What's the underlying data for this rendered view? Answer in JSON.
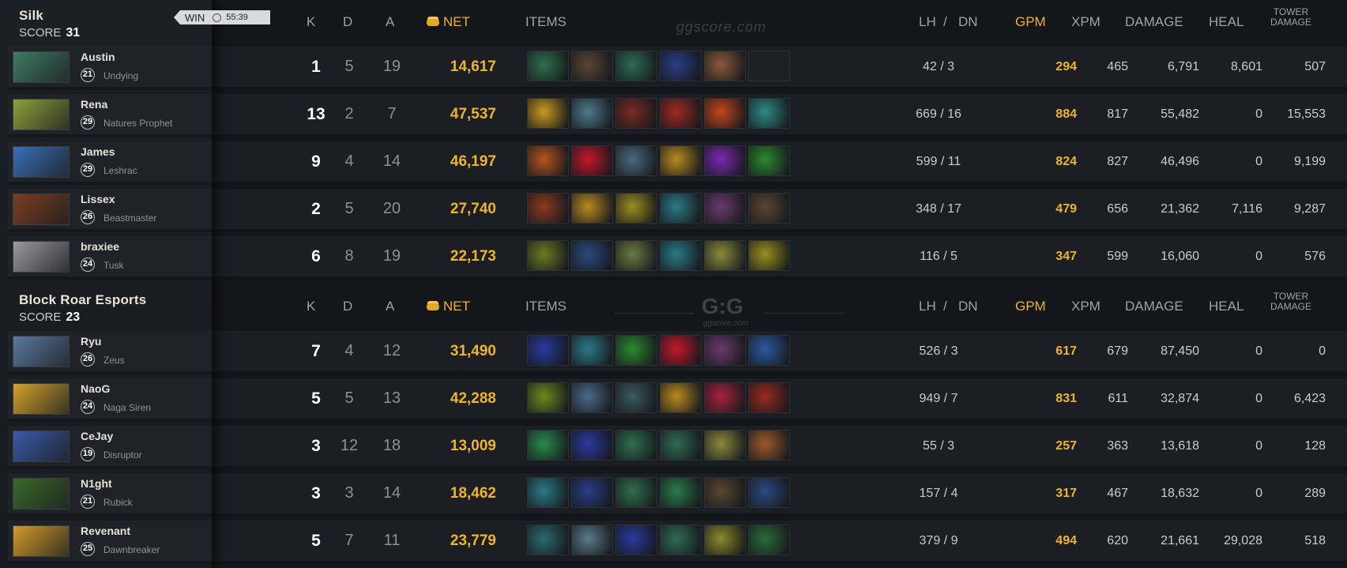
{
  "match": {
    "result": "WIN",
    "duration": "55:39"
  },
  "headers": {
    "k": "K",
    "d": "D",
    "a": "A",
    "net": "NET",
    "items": "ITEMS",
    "lh": "LH",
    "slash": "/",
    "dn": "DN",
    "gpm": "GPM",
    "xpm": "XPM",
    "damage": "DAMAGE",
    "heal": "HEAL",
    "tower_1": "TOWER",
    "tower_2": "DAMAGE",
    "watermark": "ggscore.com",
    "logo": "G:G",
    "logo_sub": "ggscore.com"
  },
  "teams": [
    {
      "name": "Silk",
      "score_label": "SCORE",
      "score": "31",
      "players": [
        {
          "name": "Austin",
          "level": "21",
          "hero": "Undying",
          "k": "1",
          "d": "5",
          "a": "19",
          "net": "14,617",
          "lh_dn": "42  /  3",
          "gpm": "294",
          "xpm": "465",
          "damage": "6,791",
          "heal": "8,601",
          "tower": "507",
          "portrait": "#3f7b66",
          "items": [
            "#2f6f4e",
            "#5a4632",
            "#2e6b54",
            "#2a3d86",
            "#8a5a3a",
            "#1e2124"
          ]
        },
        {
          "name": "Rena",
          "level": "29",
          "hero": "Natures Prophet",
          "k": "13",
          "d": "2",
          "a": "7",
          "net": "47,537",
          "lh_dn": "669  /  16",
          "gpm": "884",
          "xpm": "817",
          "damage": "55,482",
          "heal": "0",
          "tower": "15,553",
          "portrait": "#8fa03a",
          "items": [
            "#c99a1e",
            "#4d7a8a",
            "#7a2a24",
            "#9e2a22",
            "#c4461c",
            "#2e8a86"
          ]
        },
        {
          "name": "James",
          "level": "29",
          "hero": "Leshrac",
          "k": "9",
          "d": "4",
          "a": "14",
          "net": "46,197",
          "lh_dn": "599  /  11",
          "gpm": "824",
          "xpm": "827",
          "damage": "46,496",
          "heal": "0",
          "tower": "9,199",
          "portrait": "#3a6fb5",
          "items": [
            "#b4541e",
            "#c4182a",
            "#4a6a7e",
            "#b88a1e",
            "#7a28b0",
            "#2a8a2e"
          ]
        },
        {
          "name": "Lissex",
          "level": "26",
          "hero": "Beastmaster",
          "k": "2",
          "d": "5",
          "a": "20",
          "net": "27,740",
          "lh_dn": "348  /  17",
          "gpm": "479",
          "xpm": "656",
          "damage": "21,362",
          "heal": "7,116",
          "tower": "9,287",
          "portrait": "#7a3e22",
          "items": [
            "#8a3a1e",
            "#b88a1e",
            "#9a8e1e",
            "#2a7a86",
            "#6a3a6e",
            "#5a4632"
          ]
        },
        {
          "name": "braxiee",
          "level": "24",
          "hero": "Tusk",
          "k": "6",
          "d": "8",
          "a": "19",
          "net": "22,173",
          "lh_dn": "116  /  5",
          "gpm": "347",
          "xpm": "599",
          "damage": "16,060",
          "heal": "0",
          "tower": "576",
          "portrait": "#9a9aa0",
          "items": [
            "#6a7a22",
            "#2a4a7e",
            "#6a7a3e",
            "#2a7a86",
            "#8a8a3a",
            "#9a8e1e"
          ]
        }
      ]
    },
    {
      "name": "Block Roar Esports",
      "score_label": "SCORE",
      "score": "23",
      "players": [
        {
          "name": "Ryu",
          "level": "26",
          "hero": "Zeus",
          "k": "7",
          "d": "4",
          "a": "12",
          "net": "31,490",
          "lh_dn": "526  /  3",
          "gpm": "617",
          "xpm": "679",
          "damage": "87,450",
          "heal": "0",
          "tower": "0",
          "portrait": "#5a7aa0",
          "items": [
            "#2a3a9e",
            "#2a7a86",
            "#2a8a2e",
            "#c4182a",
            "#6a3a6e",
            "#2a5a9e"
          ]
        },
        {
          "name": "NaoG",
          "level": "24",
          "hero": "Naga Siren",
          "k": "5",
          "d": "5",
          "a": "13",
          "net": "42,288",
          "lh_dn": "949  /  7",
          "gpm": "831",
          "xpm": "611",
          "damage": "32,874",
          "heal": "0",
          "tower": "6,423",
          "portrait": "#d4a22a",
          "items": [
            "#6a8a1e",
            "#4a6a8a",
            "#3a5a5e",
            "#b88a1e",
            "#a8223e",
            "#9a2a1e"
          ]
        },
        {
          "name": "CeJay",
          "level": "19",
          "hero": "Disruptor",
          "k": "3",
          "d": "12",
          "a": "18",
          "net": "13,009",
          "lh_dn": "55  /  3",
          "gpm": "257",
          "xpm": "363",
          "damage": "13,618",
          "heal": "0",
          "tower": "128",
          "portrait": "#3a5aa8",
          "items": [
            "#2a8a4e",
            "#2a3a9e",
            "#2f6f4e",
            "#2e6b54",
            "#8a8a3a",
            "#9a5a2a"
          ]
        },
        {
          "name": "N1ght",
          "level": "21",
          "hero": "Rubick",
          "k": "3",
          "d": "3",
          "a": "14",
          "net": "18,462",
          "lh_dn": "157  /  4",
          "gpm": "317",
          "xpm": "467",
          "damage": "18,632",
          "heal": "0",
          "tower": "289",
          "portrait": "#3a6a2a",
          "items": [
            "#2a7a86",
            "#2a3d86",
            "#2f6f4e",
            "#2a7a4a",
            "#5a4632",
            "#2a4a7e"
          ]
        },
        {
          "name": "Revenant",
          "level": "25",
          "hero": "Dawnbreaker",
          "k": "5",
          "d": "7",
          "a": "11",
          "net": "23,779",
          "lh_dn": "379  /  9",
          "gpm": "494",
          "xpm": "620",
          "damage": "21,661",
          "heal": "29,028",
          "tower": "518",
          "portrait": "#d49a2a",
          "items": [
            "#2a6a6e",
            "#5a7a8a",
            "#2a3a9e",
            "#2e6b54",
            "#8a8a2a",
            "#2a6a3a"
          ]
        }
      ]
    }
  ]
}
